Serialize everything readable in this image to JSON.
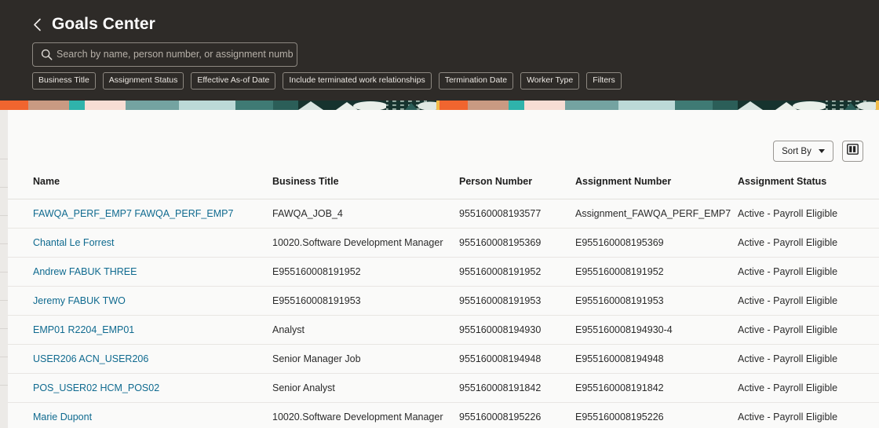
{
  "header": {
    "back_icon": "chevron-left-icon",
    "title": "Goals Center",
    "search": {
      "icon": "search-icon",
      "placeholder": "Search by name, person number, or assignment numb",
      "value": ""
    },
    "filter_chips": [
      "Business Title",
      "Assignment Status",
      "Effective As-of Date",
      "Include terminated work relationships",
      "Termination Date",
      "Worker Type",
      "Filters"
    ]
  },
  "toolbar": {
    "sort_label": "Sort By",
    "sort_caret_icon": "chevron-down-icon",
    "panel_toggle_icon": "split-panel-icon"
  },
  "table": {
    "columns": [
      "Name",
      "Business Title",
      "Person Number",
      "Assignment Number",
      "Assignment Status"
    ],
    "rows": [
      {
        "name": "FAWQA_PERF_EMP7 FAWQA_PERF_EMP7",
        "business_title": "FAWQA_JOB_4",
        "person_number": "955160008193577",
        "assignment_number": "Assignment_FAWQA_PERF_EMP7",
        "assignment_status": "Active - Payroll Eligible"
      },
      {
        "name": "Chantal Le Forrest",
        "business_title": "10020.Software Development Manager",
        "person_number": "955160008195369",
        "assignment_number": "E955160008195369",
        "assignment_status": "Active - Payroll Eligible"
      },
      {
        "name": "Andrew FABUK THREE",
        "business_title": "E955160008191952",
        "person_number": "955160008191952",
        "assignment_number": "E955160008191952",
        "assignment_status": "Active - Payroll Eligible"
      },
      {
        "name": "Jeremy FABUK TWO",
        "business_title": "E955160008191953",
        "person_number": "955160008191953",
        "assignment_number": "E955160008191953",
        "assignment_status": "Active - Payroll Eligible"
      },
      {
        "name": "EMP01 R2204_EMP01",
        "business_title": "Analyst",
        "person_number": "955160008194930",
        "assignment_number": "E955160008194930-4",
        "assignment_status": "Active - Payroll Eligible"
      },
      {
        "name": "USER206 ACN_USER206",
        "business_title": "Senior Manager Job",
        "person_number": "955160008194948",
        "assignment_number": "E955160008194948",
        "assignment_status": "Active - Payroll Eligible"
      },
      {
        "name": "POS_USER02 HCM_POS02",
        "business_title": "Senior Analyst",
        "person_number": "955160008191842",
        "assignment_number": "E955160008191842",
        "assignment_status": "Active - Payroll Eligible"
      },
      {
        "name": "Marie Dupont",
        "business_title": "10020.Software Development Manager",
        "person_number": "955160008195226",
        "assignment_number": "E955160008195226",
        "assignment_status": "Active - Payroll Eligible"
      }
    ]
  },
  "colors": {
    "header_bg": "#2e2b28",
    "content_bg": "#fafaf9",
    "link": "#0f6a8f",
    "chip_border": "#8d8881",
    "banner_orange": "#f0652f",
    "banner_teal": "#2b7d7a",
    "banner_dark_green": "#16332e",
    "banner_pink": "#f7ddd4",
    "banner_yellow": "#f0bc4a",
    "banner_lightblue": "#bcd9d7",
    "banner_tan": "#c99a82"
  }
}
